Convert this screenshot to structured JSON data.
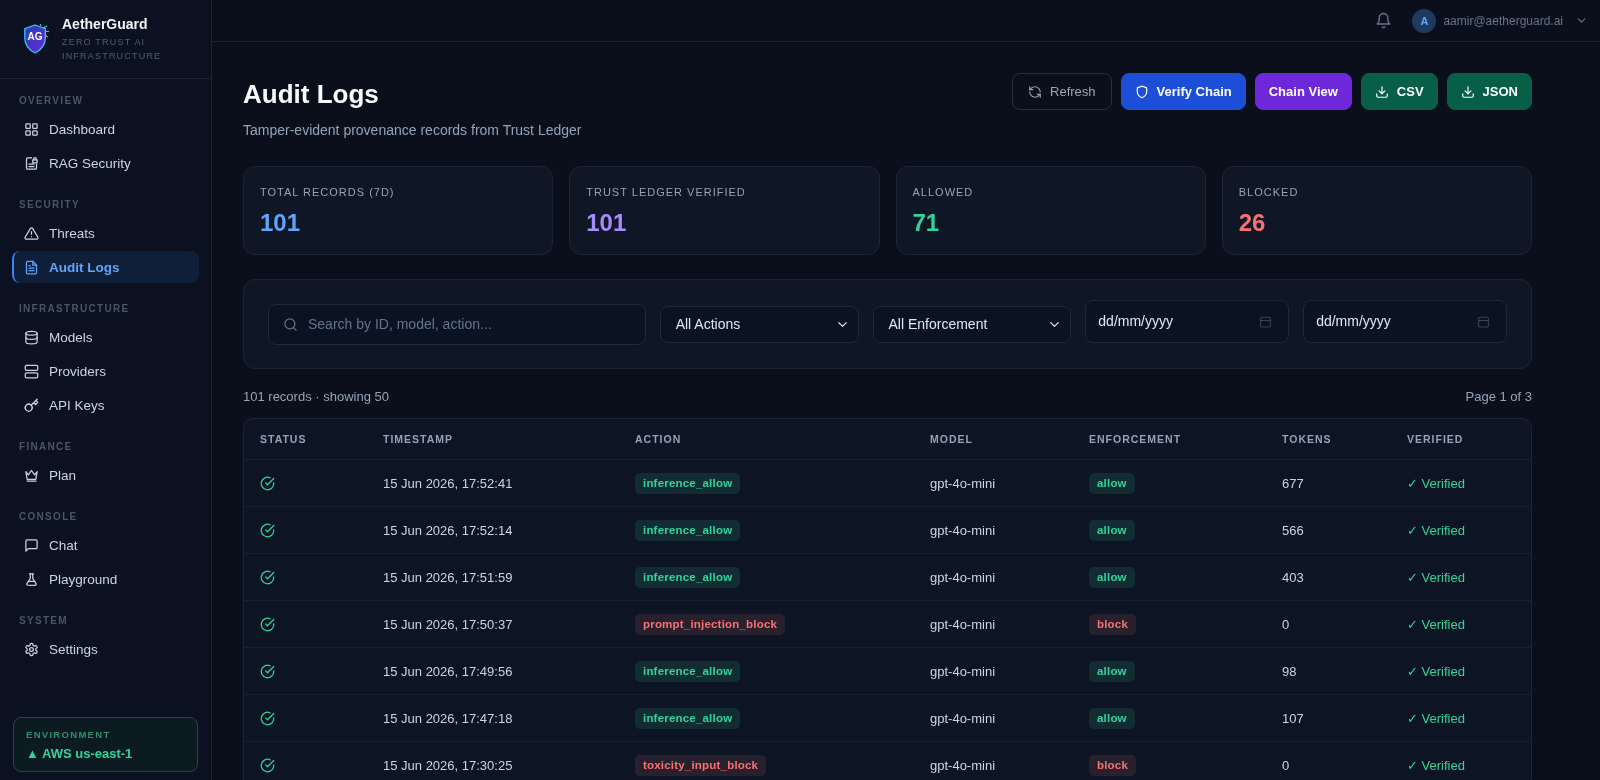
{
  "sidebar": {
    "brand": {
      "mark": "AG",
      "name": "AetherGuard",
      "tagline": "ZERO TRUST AI INFRASTRUCTURE"
    },
    "sections": [
      {
        "label": "OVERVIEW",
        "items": [
          {
            "label": "Dashboard",
            "selected": false
          },
          {
            "label": "RAG Security",
            "selected": false
          }
        ]
      },
      {
        "label": "SECURITY",
        "items": [
          {
            "label": "Threats",
            "selected": false
          },
          {
            "label": "Audit Logs",
            "selected": true
          }
        ]
      },
      {
        "label": "INFRASTRUCTURE",
        "items": [
          {
            "label": "Models",
            "selected": false
          },
          {
            "label": "Providers",
            "selected": false
          },
          {
            "label": "API Keys",
            "selected": false
          }
        ]
      },
      {
        "label": "FINANCE",
        "items": [
          {
            "label": "Plan",
            "selected": false
          }
        ]
      },
      {
        "label": "CONSOLE",
        "items": [
          {
            "label": "Chat",
            "selected": false
          },
          {
            "label": "Playground",
            "selected": false
          }
        ]
      },
      {
        "label": "SYSTEM",
        "items": [
          {
            "label": "Settings",
            "selected": false
          }
        ]
      }
    ],
    "environment": {
      "label": "ENVIRONMENT",
      "value": "▲ AWS us-east-1"
    }
  },
  "topbar": {
    "user": {
      "initial": "A",
      "email": "aamir@aetherguard.ai"
    }
  },
  "header": {
    "title": "Audit Logs",
    "subtitle": "Tamper-evident provenance records from Trust Ledger",
    "buttons": [
      {
        "label": "Refresh",
        "kind": "outline"
      },
      {
        "label": "Verify Chain",
        "kind": "filled",
        "color": "#1d4ed8"
      },
      {
        "label": "Chain View",
        "kind": "filled",
        "color": "#6d28d9"
      },
      {
        "label": "CSV",
        "kind": "filled",
        "color": "#065f46"
      },
      {
        "label": "JSON",
        "kind": "filled",
        "color": "#065f46"
      }
    ]
  },
  "stats": [
    {
      "label": "TOTAL RECORDS (7D)",
      "value": "101",
      "color": "#60a5fa"
    },
    {
      "label": "TRUST LEDGER VERIFIED",
      "value": "101",
      "color": "#a78bfa"
    },
    {
      "label": "ALLOWED",
      "value": "71",
      "color": "#34d399"
    },
    {
      "label": "BLOCKED",
      "value": "26",
      "color": "#f87171"
    }
  ],
  "filters": {
    "search": {
      "placeholder": "Search by ID, model, action..."
    },
    "selects": [
      {
        "value": "All Actions"
      },
      {
        "value": "All Enforcement"
      }
    ],
    "dates": [
      {
        "placeholder": "dd/mm/yyyy"
      },
      {
        "placeholder": "dd/mm/yyyy"
      }
    ]
  },
  "summary": {
    "count": "101 records · showing 50",
    "page": "Page 1 of 3"
  },
  "table": {
    "columns": [
      "STATUS",
      "TIMESTAMP",
      "ACTION",
      "MODEL",
      "ENFORCEMENT",
      "TOKENS",
      "VERIFIED"
    ],
    "rows": [
      {
        "timestamp": "15 Jun 2026, 17:52:41",
        "action": {
          "text": "inference_allow",
          "color": "#34d399"
        },
        "model": "gpt-4o-mini",
        "enforcement": {
          "text": "allow",
          "color": "#34d399"
        },
        "tokens": "677",
        "verified": "✓ Verified"
      },
      {
        "timestamp": "15 Jun 2026, 17:52:14",
        "action": {
          "text": "inference_allow",
          "color": "#34d399"
        },
        "model": "gpt-4o-mini",
        "enforcement": {
          "text": "allow",
          "color": "#34d399"
        },
        "tokens": "566",
        "verified": "✓ Verified"
      },
      {
        "timestamp": "15 Jun 2026, 17:51:59",
        "action": {
          "text": "inference_allow",
          "color": "#34d399"
        },
        "model": "gpt-4o-mini",
        "enforcement": {
          "text": "allow",
          "color": "#34d399"
        },
        "tokens": "403",
        "verified": "✓ Verified"
      },
      {
        "timestamp": "15 Jun 2026, 17:50:37",
        "action": {
          "text": "prompt_injection_block",
          "color": "#f87171"
        },
        "model": "gpt-4o-mini",
        "enforcement": {
          "text": "block",
          "color": "#f87171"
        },
        "tokens": "0",
        "verified": "✓ Verified"
      },
      {
        "timestamp": "15 Jun 2026, 17:49:56",
        "action": {
          "text": "inference_allow",
          "color": "#34d399"
        },
        "model": "gpt-4o-mini",
        "enforcement": {
          "text": "allow",
          "color": "#34d399"
        },
        "tokens": "98",
        "verified": "✓ Verified"
      },
      {
        "timestamp": "15 Jun 2026, 17:47:18",
        "action": {
          "text": "inference_allow",
          "color": "#34d399"
        },
        "model": "gpt-4o-mini",
        "enforcement": {
          "text": "allow",
          "color": "#34d399"
        },
        "tokens": "107",
        "verified": "✓ Verified"
      },
      {
        "timestamp": "15 Jun 2026, 17:30:25",
        "action": {
          "text": "toxicity_input_block",
          "color": "#f87171"
        },
        "model": "gpt-4o-mini",
        "enforcement": {
          "text": "block",
          "color": "#f87171"
        },
        "tokens": "0",
        "verified": "✓ Verified"
      }
    ]
  }
}
